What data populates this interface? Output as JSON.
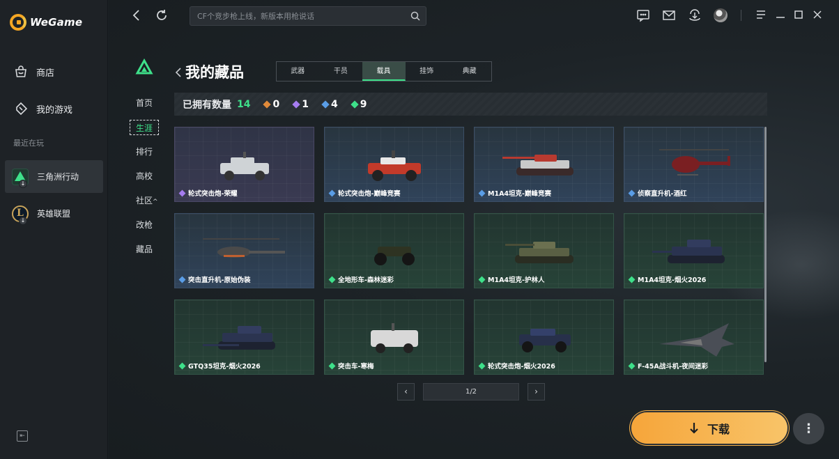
{
  "app": {
    "logo_text": "WeGame"
  },
  "sidebar": {
    "nav": [
      {
        "label": "商店",
        "icon": "store-bag-icon"
      },
      {
        "label": "我的游戏",
        "icon": "gamepad-icon"
      }
    ],
    "recent_label": "最近在玩",
    "recent": [
      {
        "label": "三角洲行动",
        "icon": "delta-force-icon",
        "active": true
      },
      {
        "label": "英雄联盟",
        "icon": "league-of-legends-icon",
        "active": false
      }
    ]
  },
  "topbar": {
    "search_placeholder": "CF个竞步枪上线，新版本用枪说话"
  },
  "content_nav": [
    {
      "label": "首页",
      "active": false
    },
    {
      "label": "生涯",
      "active": true
    },
    {
      "label": "排行",
      "active": false
    },
    {
      "label": "高校",
      "active": false
    },
    {
      "label": "社区",
      "active": false,
      "caret": "^"
    },
    {
      "label": "改枪",
      "active": false
    },
    {
      "label": "藏品",
      "active": false
    }
  ],
  "page": {
    "title": "我的藏品",
    "tabs": [
      {
        "label": "武器",
        "active": false
      },
      {
        "label": "干员",
        "active": false
      },
      {
        "label": "载具",
        "active": true
      },
      {
        "label": "挂饰",
        "active": false
      },
      {
        "label": "典藏",
        "active": false
      }
    ]
  },
  "stats": {
    "owned_label": "已拥有数量",
    "owned_count": "14",
    "rarities": [
      {
        "color": "#e08a3a",
        "count": "0"
      },
      {
        "color": "#a57cf0",
        "count": "1"
      },
      {
        "color": "#5a9de6",
        "count": "4"
      },
      {
        "color": "#3ee08a",
        "count": "9"
      }
    ]
  },
  "items": [
    {
      "name": "轮式突击炮-荣耀",
      "rarity": "purple",
      "rarity_color": "#a57cf0",
      "vehicle": "armored-car"
    },
    {
      "name": "轮式突击炮-巅峰竞赛",
      "rarity": "blue",
      "rarity_color": "#5a9de6",
      "vehicle": "armored-car-red"
    },
    {
      "name": "M1A4坦克-巅峰竞赛",
      "rarity": "blue",
      "rarity_color": "#5a9de6",
      "vehicle": "tank-red"
    },
    {
      "name": "侦察直升机-酒红",
      "rarity": "blue",
      "rarity_color": "#5a9de6",
      "vehicle": "heli-red"
    },
    {
      "name": "突击直升机-原始伪装",
      "rarity": "blue",
      "rarity_color": "#5a9de6",
      "vehicle": "attack-heli"
    },
    {
      "name": "全地形车-森林迷彩",
      "rarity": "green",
      "rarity_color": "#3ee08a",
      "vehicle": "atv"
    },
    {
      "name": "M1A4坦克-护林人",
      "rarity": "green",
      "rarity_color": "#3ee08a",
      "vehicle": "tank-camo"
    },
    {
      "name": "M1A4坦克-烟火2026",
      "rarity": "green",
      "rarity_color": "#3ee08a",
      "vehicle": "tank-navy"
    },
    {
      "name": "GTQ35坦克-烟火2026",
      "rarity": "green",
      "rarity_color": "#3ee08a",
      "vehicle": "tank-navy2"
    },
    {
      "name": "突击车-寒梅",
      "rarity": "green",
      "rarity_color": "#3ee08a",
      "vehicle": "apc-white"
    },
    {
      "name": "轮式突击炮-烟火2026",
      "rarity": "green",
      "rarity_color": "#3ee08a",
      "vehicle": "armored-car-navy"
    },
    {
      "name": "F-45A战斗机-夜间迷彩",
      "rarity": "green",
      "rarity_color": "#3ee08a",
      "vehicle": "jet"
    }
  ],
  "pagination": {
    "label": "1/2"
  },
  "download": {
    "label": "下载"
  }
}
